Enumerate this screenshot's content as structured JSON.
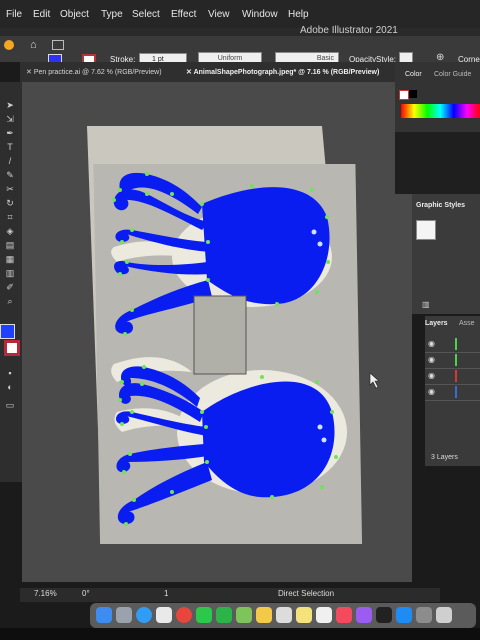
{
  "menubar": {
    "items": [
      "File",
      "Edit",
      "Object",
      "Type",
      "Select",
      "Effect",
      "View",
      "Window",
      "Help"
    ],
    "app_title": "Adobe Illustrator 2021"
  },
  "control_bar": {
    "stroke_label": "Stroke:",
    "stroke_value": "1 pt",
    "uniform_label": "Uniform",
    "basic_label": "Basic",
    "opacity_label": "Opacity",
    "style_label": "Style:",
    "corner_label": "Corner"
  },
  "tabs": [
    {
      "label": "Pen practice.ai @ 7.62 % (RGB/Preview)"
    },
    {
      "label": "AnimalShapePhotograph.jpeg* @ 7.16 % (RGB/Preview)"
    }
  ],
  "color_panel": {
    "tab_color": "Color",
    "tab_guide": "Color Guide"
  },
  "graphic_styles": {
    "title": "Graphic Styles"
  },
  "layers_panel": {
    "tab_layers": "Layers",
    "tab_assets": "Asse",
    "footer": "3 Layers",
    "layer_colors": [
      "#4fd14f",
      "#d23a3a",
      "#3a6dd2"
    ]
  },
  "status_bar": {
    "zoom": "7.16%",
    "rotation": "0°",
    "artboard": "1",
    "tool": "Direct Selection"
  },
  "colors": {
    "selection_fill": "#0a1df0",
    "anchor_point": "#6fe35c",
    "artboard": "#c9c7be",
    "photo_bg": "#b8b7b1"
  },
  "dock": {
    "icons": [
      "finder",
      "launchpad",
      "safari",
      "photos",
      "chrome",
      "messages",
      "facetime",
      "maps",
      "photos-app",
      "calendar",
      "notes",
      "reminders",
      "music",
      "podcasts",
      "tv",
      "appstore",
      "settings",
      "preview"
    ]
  }
}
